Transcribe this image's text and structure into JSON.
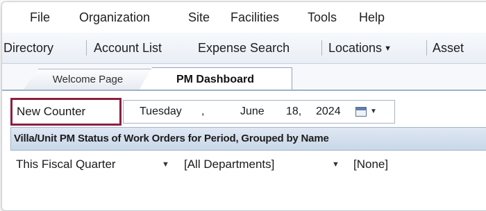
{
  "menu": [
    "File",
    "Organization",
    "Site",
    "Facilities",
    "Tools",
    "Help"
  ],
  "toolbar": {
    "directory": "Directory",
    "account_list": "Account List",
    "expense_search": "Expense Search",
    "locations": "Locations",
    "assets": "Asset"
  },
  "tabs": {
    "welcome": "Welcome Page",
    "pm_dashboard": "PM Dashboard"
  },
  "date": {
    "new_counter": "New Counter",
    "weekday": "Tuesday",
    "sep": ",",
    "month": "June",
    "daynum": "18,",
    "year": "2024"
  },
  "report": {
    "title": "Villa/Unit PM Status of Work Orders for Period, Grouped by Name"
  },
  "filters": {
    "period": "This Fiscal Quarter",
    "departments": "[All Departments]",
    "grouping": "[None]"
  },
  "colors": {
    "highlight_border": "#8b1f3f",
    "tab_border": "#8ea3bd"
  }
}
